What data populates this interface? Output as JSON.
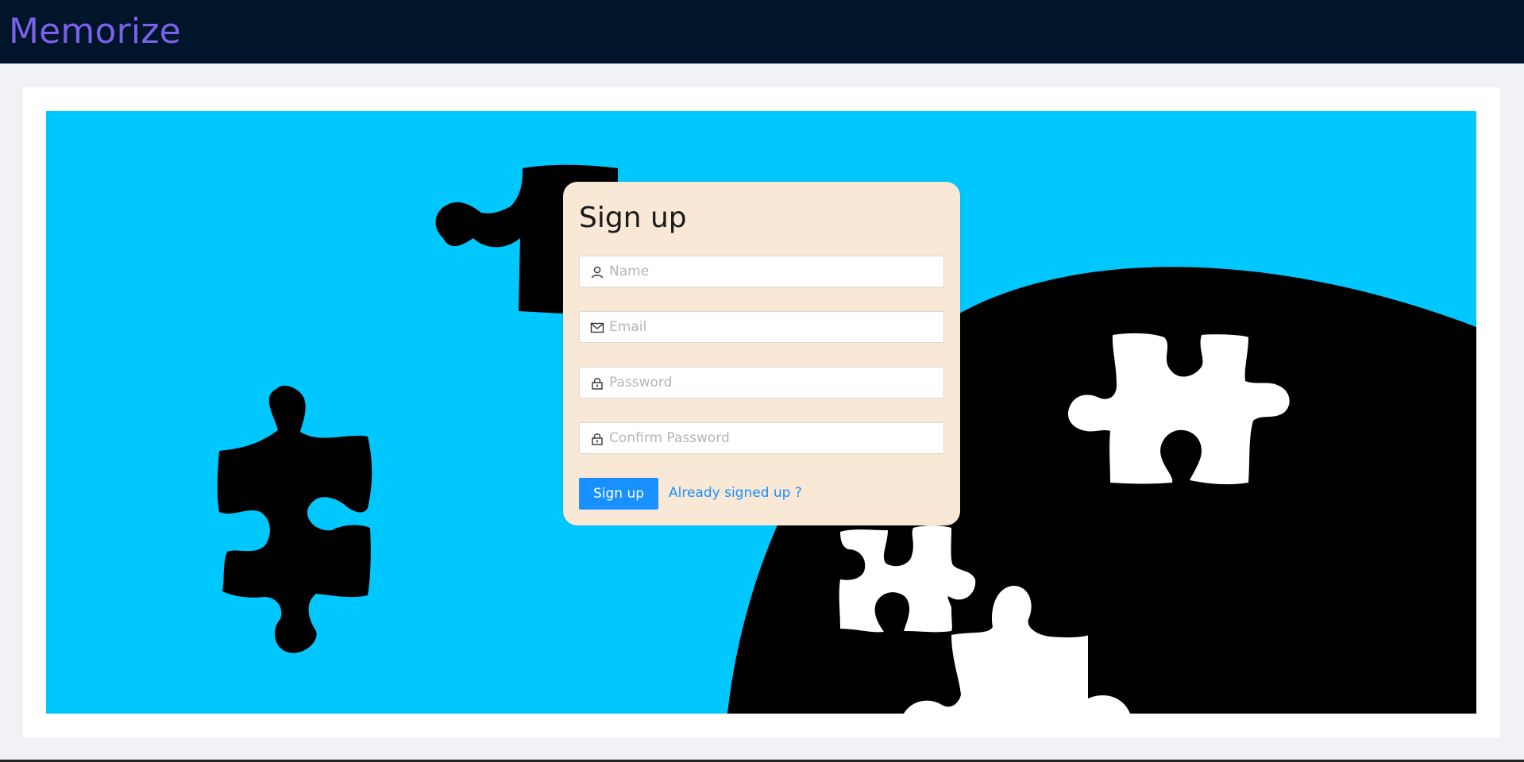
{
  "header": {
    "brand": "Memorize",
    "bg_color": "#001529",
    "brand_color": "#7b61e8"
  },
  "hero": {
    "background_color": "#00c8ff",
    "illustration": "puzzle-pieces"
  },
  "signup_form": {
    "title": "Sign up",
    "fields": {
      "name": {
        "icon": "user-icon",
        "placeholder": "Name",
        "value": ""
      },
      "email": {
        "icon": "mail-icon",
        "placeholder": "Email",
        "value": ""
      },
      "password": {
        "icon": "lock-icon",
        "placeholder": "Password",
        "value": ""
      },
      "confirm_password": {
        "icon": "lock-icon",
        "placeholder": "Confirm Password",
        "value": ""
      }
    },
    "submit_label": "Sign up",
    "signin_link": "Already signed up ?",
    "panel_color": "#f8e8d5",
    "accent_color": "#1890ff"
  }
}
